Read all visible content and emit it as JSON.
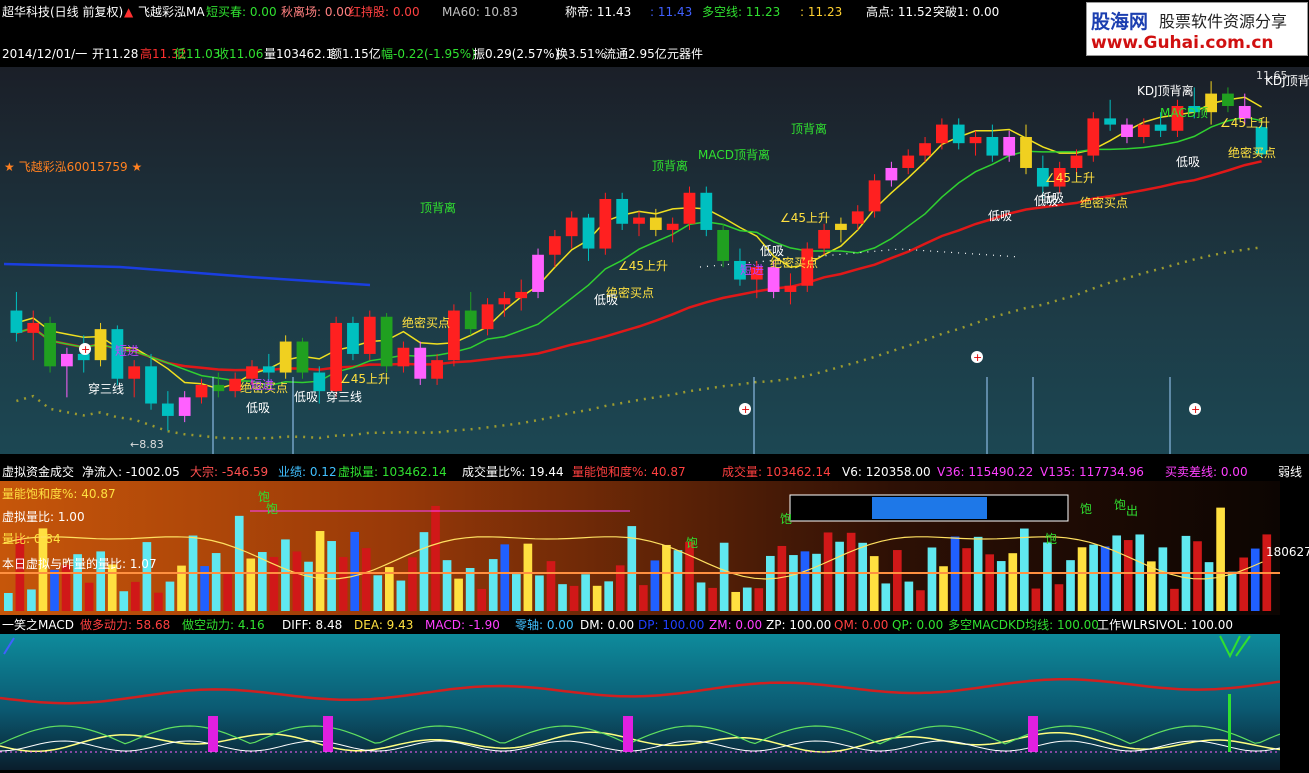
{
  "topbar": {
    "title": "超华科技(日线 前复权)",
    "indicator": "飞越彩泓MA",
    "l1": "短买春: 0.00",
    "l2": "秋离场: 0.00",
    "l3": "红持股: 0.00",
    "ma60": "MA60: 10.83",
    "l4": "称帝: 11.43",
    "l5": ": 11.43",
    "l6": "多空线: 11.23",
    "l7": ": 11.23",
    "l8": "高点: 11.52",
    "l9": "突破1: 0.00"
  },
  "infobar": {
    "date": "2014/12/01/一",
    "open": "开11.28",
    "high": "高11.32",
    "low": "低11.03",
    "close": "收11.06",
    "vol": "量103462.1",
    "amt": "额1.15亿",
    "chg": "幅-0.22(-1.95%)",
    "amp": "振0.29(2.57%)",
    "turn": "换3.51%",
    "flow": "流通2.95亿",
    "sector": "元器件"
  },
  "logo": {
    "cn": "股海网",
    "slogan": "股票软件资源分享",
    "url": "www.Guhai.com.cn"
  },
  "panel1": {
    "star_label": "★ 飞越彩泓60015759 ★",
    "price_low": "←8.83",
    "price_high": "11.65",
    "annotations": [
      "顶背离",
      "顶背离",
      "MACD顶背离",
      "顶背离",
      "KDJ顶背离",
      "MACD顶",
      "KDJ顶背离",
      "绝密买点",
      "绝密买点",
      "绝密买点",
      "绝密买点",
      "绝密买点",
      "绝密买点",
      "∠45上升",
      "∠45上升",
      "∠45上升",
      "∠45上升",
      "∠45上升",
      "低吸",
      "低吸",
      "低吸",
      "低吸",
      "低吸",
      "低吸",
      "低吸",
      "低吸",
      "穿三线",
      "穿三线",
      "短进",
      "短进",
      "短进"
    ]
  },
  "panel2": {
    "title": "虚拟资金成交",
    "f1": "净流入: -1002.05",
    "f2": "大宗: -546.59",
    "f3": "业绩: 0.12",
    "f4": "虚拟量: 103462.14",
    "f5": "成交量比%: 19.44",
    "f6": "量能饱和度%: 40.87",
    "f7": "成交量: 103462.14",
    "f8": "V6: 120358.00",
    "f9": "V36: 115490.22",
    "f10": "V135: 117734.96",
    "f11": "买卖差线: 0.00",
    "f12": "弱线",
    "lbl1": "量能饱和度%: 40.87",
    "lbl2": "虚拟量比: 1.00",
    "lbl3": "量比: 0.84",
    "lbl4": "本日虚拟与昨量的量比: 1.07",
    "right_val": "180627",
    "marks": [
      "饱",
      "饱",
      "饱",
      "饱",
      "饱",
      "饱",
      "饱",
      "出"
    ]
  },
  "panel3": {
    "title": "一笑之MACD",
    "f1": "做多动力: 58.68",
    "f2": "做空动力: 4.16",
    "f3": "DIFF: 8.48",
    "f4": "DEA: 9.43",
    "f5": "MACD: -1.90",
    "f6": "零轴: 0.00",
    "f7": "DM: 0.00",
    "f8": "DP: 100.00",
    "f9": "ZM: 0.00",
    "f10": "ZP: 100.00",
    "f11": "QM: 0.00",
    "f12": "QP: 0.00",
    "f13": "多空MACDKD均线: 100.00",
    "f14": "工作WLRSIVOL: 100.00"
  },
  "colors": {
    "up": "#ff2020",
    "down": "#00c0c0",
    "ma_red": "#e01818",
    "ma_yellow": "#f0e020",
    "ma_green": "#30d030",
    "ma_blue": "#1a3ee0",
    "magenta": "#ff60ff"
  },
  "chart_data": {
    "type": "candlestick",
    "price_range": [
      8.83,
      11.65
    ],
    "candles": [
      [
        9.8,
        9.95,
        9.55,
        9.62
      ],
      [
        9.62,
        9.8,
        9.4,
        9.7
      ],
      [
        9.7,
        9.75,
        9.3,
        9.35
      ],
      [
        9.35,
        9.5,
        9.1,
        9.45
      ],
      [
        9.45,
        9.6,
        9.3,
        9.4
      ],
      [
        9.4,
        9.7,
        9.35,
        9.65
      ],
      [
        9.65,
        9.68,
        9.2,
        9.25
      ],
      [
        9.25,
        9.4,
        9.1,
        9.35
      ],
      [
        9.35,
        9.45,
        9.0,
        9.05
      ],
      [
        9.05,
        9.15,
        8.83,
        8.95
      ],
      [
        8.95,
        9.15,
        8.9,
        9.1
      ],
      [
        9.1,
        9.25,
        9.05,
        9.2
      ],
      [
        9.2,
        9.3,
        9.1,
        9.15
      ],
      [
        9.15,
        9.3,
        9.1,
        9.25
      ],
      [
        9.25,
        9.4,
        9.2,
        9.35
      ],
      [
        9.35,
        9.45,
        9.2,
        9.3
      ],
      [
        9.3,
        9.6,
        9.25,
        9.55
      ],
      [
        9.55,
        9.58,
        9.25,
        9.3
      ],
      [
        9.3,
        9.35,
        9.05,
        9.15
      ],
      [
        9.15,
        9.75,
        9.1,
        9.7
      ],
      [
        9.7,
        9.75,
        9.4,
        9.45
      ],
      [
        9.45,
        9.8,
        9.4,
        9.75
      ],
      [
        9.75,
        9.78,
        9.3,
        9.35
      ],
      [
        9.35,
        9.55,
        9.3,
        9.5
      ],
      [
        9.5,
        9.55,
        9.2,
        9.25
      ],
      [
        9.25,
        9.45,
        9.2,
        9.4
      ],
      [
        9.4,
        9.85,
        9.35,
        9.8
      ],
      [
        9.8,
        9.95,
        9.6,
        9.65
      ],
      [
        9.65,
        9.9,
        9.6,
        9.85
      ],
      [
        9.85,
        9.95,
        9.75,
        9.9
      ],
      [
        9.9,
        10.05,
        9.8,
        9.95
      ],
      [
        9.95,
        10.3,
        9.9,
        10.25
      ],
      [
        10.25,
        10.45,
        10.15,
        10.4
      ],
      [
        10.4,
        10.6,
        10.3,
        10.55
      ],
      [
        10.55,
        10.58,
        10.2,
        10.3
      ],
      [
        10.3,
        10.75,
        10.25,
        10.7
      ],
      [
        10.7,
        10.75,
        10.45,
        10.5
      ],
      [
        10.5,
        10.6,
        10.4,
        10.55
      ],
      [
        10.55,
        10.62,
        10.4,
        10.45
      ],
      [
        10.45,
        10.55,
        10.35,
        10.5
      ],
      [
        10.5,
        10.8,
        10.45,
        10.75
      ],
      [
        10.75,
        10.8,
        10.4,
        10.45
      ],
      [
        10.45,
        10.5,
        10.15,
        10.2
      ],
      [
        10.2,
        10.3,
        10.0,
        10.05
      ],
      [
        10.05,
        10.2,
        9.9,
        10.15
      ],
      [
        10.15,
        10.2,
        9.9,
        9.95
      ],
      [
        9.95,
        10.1,
        9.85,
        10.0
      ],
      [
        10.0,
        10.35,
        9.95,
        10.3
      ],
      [
        10.3,
        10.5,
        10.25,
        10.45
      ],
      [
        10.45,
        10.55,
        10.35,
        10.5
      ],
      [
        10.5,
        10.65,
        10.45,
        10.6
      ],
      [
        10.6,
        10.9,
        10.55,
        10.85
      ],
      [
        10.85,
        11.0,
        10.8,
        10.95
      ],
      [
        10.95,
        11.1,
        10.9,
        11.05
      ],
      [
        11.05,
        11.2,
        11.0,
        11.15
      ],
      [
        11.15,
        11.35,
        11.1,
        11.3
      ],
      [
        11.3,
        11.35,
        11.1,
        11.15
      ],
      [
        11.15,
        11.25,
        11.05,
        11.2
      ],
      [
        11.2,
        11.3,
        11.0,
        11.05
      ],
      [
        11.05,
        11.25,
        11.0,
        11.2
      ],
      [
        11.2,
        11.3,
        10.9,
        10.95
      ],
      [
        10.95,
        11.05,
        10.7,
        10.8
      ],
      [
        10.8,
        11.0,
        10.75,
        10.95
      ],
      [
        10.95,
        11.1,
        10.9,
        11.05
      ],
      [
        11.05,
        11.4,
        11.0,
        11.35
      ],
      [
        11.35,
        11.5,
        11.25,
        11.3
      ],
      [
        11.3,
        11.35,
        11.15,
        11.2
      ],
      [
        11.2,
        11.35,
        11.15,
        11.3
      ],
      [
        11.3,
        11.4,
        11.2,
        11.25
      ],
      [
        11.25,
        11.5,
        11.2,
        11.45
      ],
      [
        11.45,
        11.6,
        11.35,
        11.4
      ],
      [
        11.4,
        11.65,
        11.3,
        11.55
      ],
      [
        11.55,
        11.6,
        11.4,
        11.45
      ],
      [
        11.45,
        11.55,
        11.3,
        11.35
      ],
      [
        11.28,
        11.32,
        11.03,
        11.06
      ]
    ]
  }
}
